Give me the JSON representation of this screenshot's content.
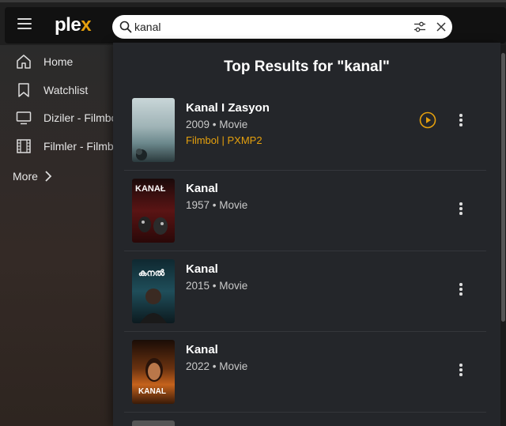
{
  "header": {
    "logo": {
      "main": "ple",
      "accent": "x"
    },
    "search": {
      "value": "kanal",
      "placeholder": ""
    }
  },
  "sidebar": {
    "items": [
      {
        "label": "Home",
        "icon": "home-icon"
      },
      {
        "label": "Watchlist",
        "icon": "bookmark-icon"
      },
      {
        "label": "Diziler - Filmbol",
        "icon": "tv-icon"
      },
      {
        "label": "Filmler - Filmbol",
        "icon": "film-icon"
      }
    ],
    "more_label": "More"
  },
  "results": {
    "title": "Top Results for \"kanal\"",
    "items": [
      {
        "title": "Kanal I Zasyon",
        "meta": "2009 • Movie",
        "source": "Filmbol | PXMP2",
        "poster_text": ""
      },
      {
        "title": "Kanal",
        "meta": "1957 • Movie",
        "source": "",
        "poster_text": "KANAŁ"
      },
      {
        "title": "Kanal",
        "meta": "2015 • Movie",
        "source": "",
        "poster_text": "കനൽ"
      },
      {
        "title": "Kanal",
        "meta": "2022 • Movie",
        "source": "",
        "poster_text": "KANAL"
      }
    ]
  },
  "colors": {
    "accent": "#e5a00d",
    "panel": "#24262a",
    "topbar": "#111111"
  }
}
